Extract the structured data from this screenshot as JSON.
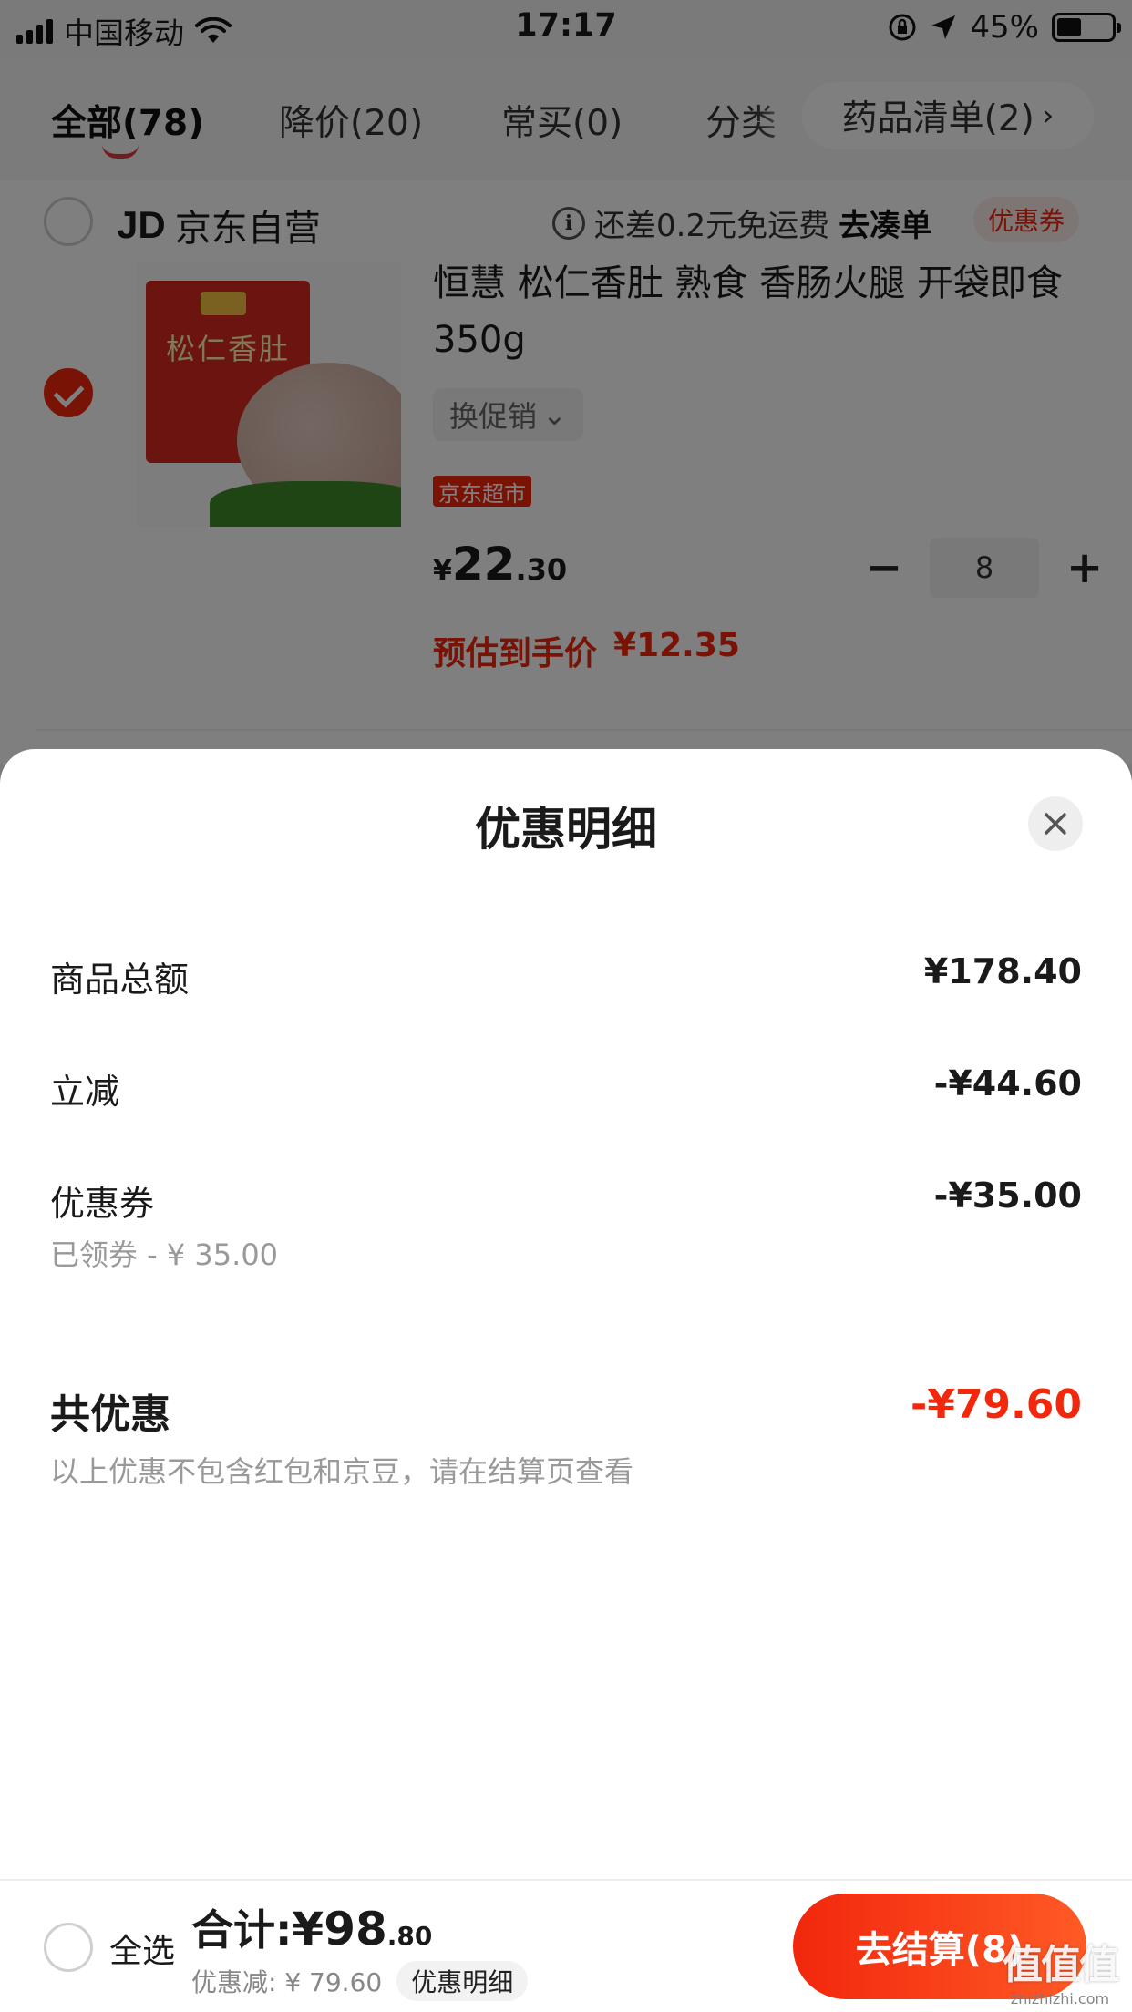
{
  "status_bar": {
    "carrier": "中国移动",
    "time": "17:17",
    "battery_percent": "45%",
    "battery_level": 0.45
  },
  "tabs": [
    {
      "label": "全部(78)",
      "active": true
    },
    {
      "label": "降价(20)",
      "active": false
    },
    {
      "label": "常买(0)",
      "active": false
    },
    {
      "label": "分类",
      "active": false
    }
  ],
  "tab_more": {
    "label": "药品清单(2)",
    "icon": "chevron-right-icon"
  },
  "shop": {
    "logo": "JD",
    "name": "京东自营",
    "shipping_note": "还差0.2元免运费",
    "shipping_link": "去凑单",
    "coupon_tag": "优惠券"
  },
  "product": {
    "image_text": "松仁香肚",
    "title": "恒慧 松仁香肚 熟食 香肠火腿 开袋即食 350g",
    "promo_switch": "换促销",
    "store_tag": "京东超市",
    "price_symbol": "¥",
    "price_int": "22",
    "price_dec": ".30",
    "quantity": "8",
    "minus": "−",
    "plus": "+",
    "est_label": "预估到手价",
    "est_price": "¥12.35"
  },
  "sheet": {
    "title": "优惠明细",
    "rows": [
      {
        "label": "商品总额",
        "value": "¥178.40"
      },
      {
        "label": "立减",
        "value": "-¥44.60"
      },
      {
        "label": "优惠券",
        "value": "-¥35.00",
        "sub": "已领券 - ¥ 35.00"
      }
    ],
    "total": {
      "label": "共优惠",
      "value": "-¥79.60",
      "note": "以上优惠不包含红包和京豆，请在结算页查看"
    }
  },
  "bottom_bar": {
    "select_all": "全选",
    "total_label": "合计:",
    "total_int": "¥98",
    "total_dec": ".80",
    "discount_text": "优惠减: ¥ 79.60",
    "detail_chip": "优惠明细",
    "checkout": "去结算(8)"
  },
  "watermark": {
    "main": "值值值",
    "sub": "zhizhizhi.com"
  },
  "colors": {
    "accent": "#f2270c",
    "overlay": "rgba(0,0,0,0.5)"
  }
}
